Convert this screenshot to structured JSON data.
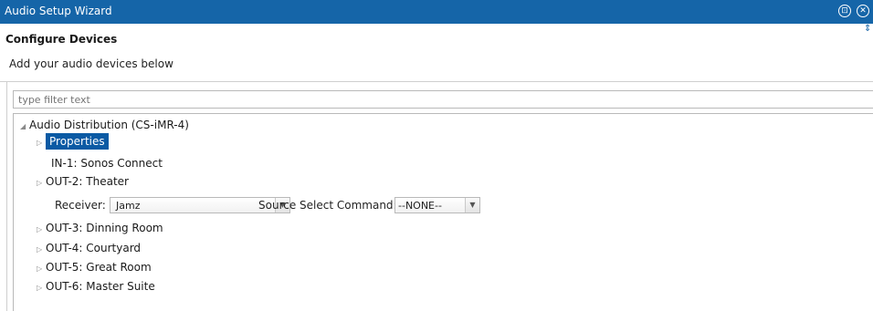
{
  "window": {
    "title": "Audio Setup Wizard"
  },
  "section": {
    "title": "Configure Devices",
    "description": "Add your audio devices below"
  },
  "filter": {
    "placeholder": "type filter text"
  },
  "tree": {
    "root": "Audio Distribution (CS-iMR-4)",
    "items": [
      "Properties",
      "IN-1: Sonos Connect",
      "OUT-2: Theater",
      "OUT-3: Dinning Room",
      "OUT-4: Courtyard",
      "OUT-5: Great Room",
      "OUT-6: Master Suite"
    ]
  },
  "receiver": {
    "label": "Receiver:",
    "value": "Jamz",
    "command_label": "Source Select Command:",
    "command_value": "--NONE--"
  },
  "icons": {
    "restore": "restore-icon",
    "close": "close-icon",
    "collapse": "triangle-down-icon",
    "expand": "triangle-right-icon",
    "dropdown": "chevron-down-icon"
  },
  "colors": {
    "titlebar": "#1565a8",
    "selection": "#0b5aa4"
  }
}
